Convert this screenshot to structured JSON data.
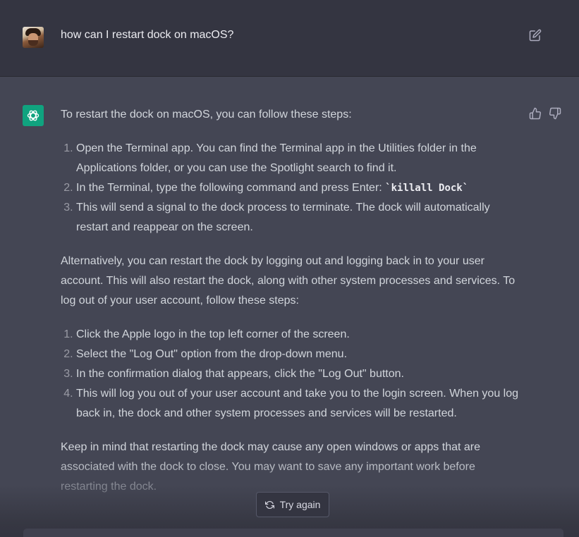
{
  "user_message": {
    "text": "how can I restart dock on macOS?"
  },
  "assistant_message": {
    "intro": "To restart the dock on macOS, you can follow these steps:",
    "steps_1": [
      "Open the Terminal app. You can find the Terminal app in the Utilities folder in the Applications folder, or you can use the Spotlight search to find it.",
      "In the Terminal, type the following command and press Enter: ",
      "This will send a signal to the dock process to terminate. The dock will automatically restart and reappear on the screen."
    ],
    "command": "`killall Dock`",
    "alternative": "Alternatively, you can restart the dock by logging out and logging back in to your user account. This will also restart the dock, along with other system processes and services. To log out of your user account, follow these steps:",
    "steps_2": [
      "Click the Apple logo in the top left corner of the screen.",
      "Select the \"Log Out\" option from the drop-down menu.",
      "In the confirmation dialog that appears, click the \"Log Out\" button.",
      "This will log you out of your user account and take you to the login screen. When you log back in, the dock and other system processes and services will be restarted."
    ],
    "closing": "Keep in mind that restarting the dock may cause any open windows or apps that are associated with the dock to close. You may want to save any important work before restarting the dock."
  },
  "controls": {
    "try_again_label": "Try again"
  },
  "icons": {
    "edit": "edit-icon",
    "thumbs_up": "thumbs-up-icon",
    "thumbs_down": "thumbs-down-icon",
    "refresh": "refresh-icon",
    "assistant_logo": "openai-logo-icon"
  },
  "colors": {
    "user_bg": "#343541",
    "assistant_bg": "#444654",
    "assistant_avatar": "#10a37f",
    "text": "#d1d5db"
  }
}
